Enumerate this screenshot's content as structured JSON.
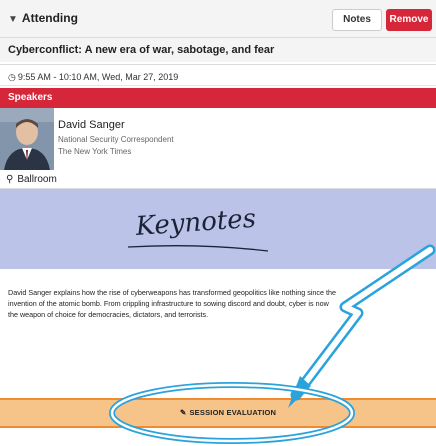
{
  "header": {
    "attending_label": "Attending",
    "chevron": "chevron-down-icon",
    "notes_label": "Notes",
    "remove_label": "Remove"
  },
  "session": {
    "title": "Cyberconflict: A new era of war, sabotage, and fear",
    "time": "9:55 AM - 10:10 AM, Wed, Mar 27, 2019",
    "location": "Ballroom"
  },
  "speakers": {
    "header": "Speakers",
    "items": [
      {
        "name": "David Sanger",
        "role": "National Security Correspondent",
        "org": "The New York Times"
      }
    ]
  },
  "banner": {
    "text": "Keynotes"
  },
  "description": "David Sanger explains how the rise of cyberweapons has transformed geopolitics like nothing since the invention of the atomic bomb. From crippling infrastructure to sowing discord and doubt, cyber is now the weapon of choice for democracies, dictators, and terrorists.",
  "evaluation": {
    "label": "SESSION EVALUATION"
  },
  "colors": {
    "brand_red": "#d6263a",
    "banner_bg": "#bcc3e9",
    "eval_bg": "#f6c388",
    "eval_border": "#f08b30",
    "annotation_blue": "#2aa3dc"
  }
}
